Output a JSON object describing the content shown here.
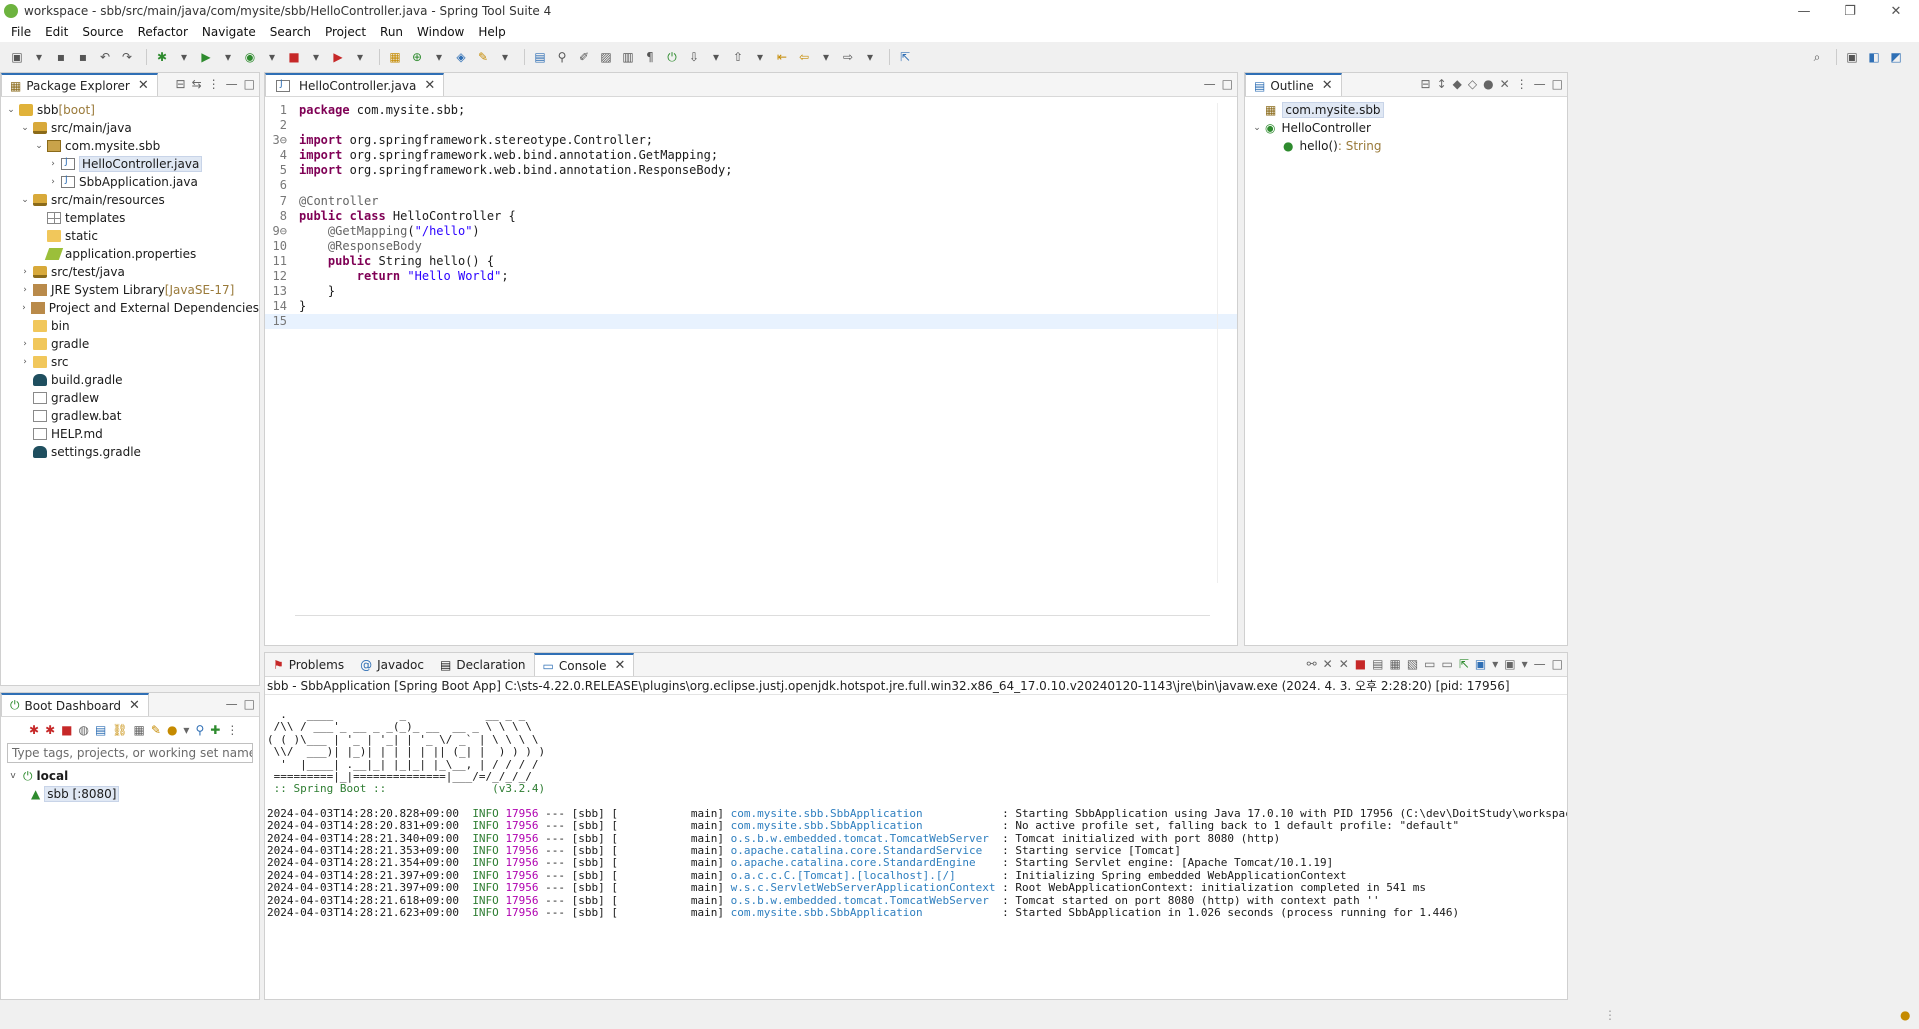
{
  "window": {
    "title": "workspace - sbb/src/main/java/com/mysite/sbb/HelloController.java - Spring Tool Suite 4",
    "controls": [
      "—",
      "❐",
      "✕"
    ]
  },
  "menu": [
    "File",
    "Edit",
    "Source",
    "Refactor",
    "Navigate",
    "Search",
    "Project",
    "Run",
    "Window",
    "Help"
  ],
  "package_explorer": {
    "title": "Package Explorer",
    "tree": [
      {
        "indent": 0,
        "twisty": "v",
        "icon": "proj",
        "label": "sbb",
        "suffix": " [boot]"
      },
      {
        "indent": 1,
        "twisty": "v",
        "icon": "srcf",
        "label": "src/main/java",
        "suffix": ""
      },
      {
        "indent": 2,
        "twisty": "v",
        "icon": "pkgi",
        "label": "com.mysite.sbb",
        "suffix": ""
      },
      {
        "indent": 3,
        "twisty": ">",
        "icon": "jfile",
        "label": "HelloController.java",
        "suffix": "",
        "selected": true
      },
      {
        "indent": 3,
        "twisty": ">",
        "icon": "jfile",
        "label": "SbbApplication.java",
        "suffix": ""
      },
      {
        "indent": 1,
        "twisty": "v",
        "icon": "srcf",
        "label": "src/main/resources",
        "suffix": ""
      },
      {
        "indent": 2,
        "twisty": "",
        "icon": "tmpl",
        "label": "templates",
        "suffix": ""
      },
      {
        "indent": 2,
        "twisty": "",
        "icon": "folder",
        "label": "static",
        "suffix": ""
      },
      {
        "indent": 2,
        "twisty": "",
        "icon": "prop",
        "label": "application.properties",
        "suffix": ""
      },
      {
        "indent": 1,
        "twisty": ">",
        "icon": "srcf",
        "label": "src/test/java",
        "suffix": ""
      },
      {
        "indent": 1,
        "twisty": ">",
        "icon": "lib",
        "label": "JRE System Library",
        "suffix": " [JavaSE-17]"
      },
      {
        "indent": 1,
        "twisty": ">",
        "icon": "lib",
        "label": "Project and External Dependencies",
        "suffix": ""
      },
      {
        "indent": 1,
        "twisty": "",
        "icon": "folder",
        "label": "bin",
        "suffix": ""
      },
      {
        "indent": 1,
        "twisty": ">",
        "icon": "folder",
        "label": "gradle",
        "suffix": ""
      },
      {
        "indent": 1,
        "twisty": ">",
        "icon": "folder",
        "label": "src",
        "suffix": ""
      },
      {
        "indent": 1,
        "twisty": "",
        "icon": "grd",
        "label": "build.gradle",
        "suffix": ""
      },
      {
        "indent": 1,
        "twisty": "",
        "icon": "file",
        "label": "gradlew",
        "suffix": ""
      },
      {
        "indent": 1,
        "twisty": "",
        "icon": "file",
        "label": "gradlew.bat",
        "suffix": ""
      },
      {
        "indent": 1,
        "twisty": "",
        "icon": "file",
        "label": "HELP.md",
        "suffix": ""
      },
      {
        "indent": 1,
        "twisty": "",
        "icon": "grd",
        "label": "settings.gradle",
        "suffix": ""
      }
    ]
  },
  "editor": {
    "tab": "HelloController.java",
    "lines": [
      {
        "n": "1",
        "html": "<span class='kw'>package</span> com.mysite.sbb;"
      },
      {
        "n": "2",
        "html": ""
      },
      {
        "n": "3⊖",
        "html": "<span class='kw'>import</span> org.springframework.stereotype.Controller;"
      },
      {
        "n": "4",
        "html": "<span class='kw'>import</span> org.springframework.web.bind.annotation.GetMapping;"
      },
      {
        "n": "5",
        "html": "<span class='kw'>import</span> org.springframework.web.bind.annotation.ResponseBody;"
      },
      {
        "n": "6",
        "html": ""
      },
      {
        "n": "7",
        "html": "<span class='ann'>@Controller</span>"
      },
      {
        "n": "8",
        "html": "<span class='kw'>public class</span> HelloController {"
      },
      {
        "n": "9⊖",
        "html": "    <span class='ann'>@GetMapping</span>(<span class='str'>\"/hello\"</span>)"
      },
      {
        "n": "10",
        "html": "    <span class='ann'>@ResponseBody</span>"
      },
      {
        "n": "11",
        "html": "    <span class='kw'>public</span> String hello() {"
      },
      {
        "n": "12",
        "html": "        <span class='kw'>return</span> <span class='str'>\"Hello World\"</span>;"
      },
      {
        "n": "13",
        "html": "    }"
      },
      {
        "n": "14",
        "html": "}"
      },
      {
        "n": "15",
        "html": "",
        "current": true
      }
    ]
  },
  "outline": {
    "title": "Outline",
    "items": [
      {
        "indent": 0,
        "twisty": "",
        "label": "com.mysite.sbb",
        "type": "",
        "selected": true
      },
      {
        "indent": 0,
        "twisty": "v",
        "label": "HelloController",
        "type": ""
      },
      {
        "indent": 1,
        "twisty": "",
        "label": "hello()",
        "type": " : String"
      }
    ]
  },
  "boot_dashboard": {
    "title": "Boot Dashboard",
    "search_placeholder": "Type tags, projects, or working set names to match (incl",
    "group": "local",
    "app": "sbb [:8080]"
  },
  "bottom_tabs": {
    "problems": "Problems",
    "javadoc": "Javadoc",
    "declaration": "Declaration",
    "console": "Console"
  },
  "console": {
    "header": "sbb - SbbApplication [Spring Boot App] C:\\sts-4.22.0.RELEASE\\plugins\\org.eclipse.justj.openjdk.hotspot.jre.full.win32.x86_64_17.0.10.v20240120-1143\\jre\\bin\\javaw.exe  (2024. 4. 3. 오후 2:28:20) [pid: 17956]",
    "banner": [
      "  .   ____          _            __ _ _",
      " /\\\\ / ___'_ __ _ _(_)_ __  __ _ \\ \\ \\ \\",
      "( ( )\\___ | '_ | '_| | '_ \\/ _` | \\ \\ \\ \\",
      " \\\\/  ___)| |_)| | | | | || (_| |  ) ) ) )",
      "  '  |____| .__|_| |_|_| |_\\__, | / / / /",
      " =========|_|==============|___/=/_/_/_/",
      " :: Spring Boot ::                (v3.2.4)"
    ],
    "logs": [
      {
        "ts": "2024-04-03T14:28:20.828+09:00",
        "lvl": "INFO",
        "pid": "17956",
        "mid": " --- [sbb] [           main] ",
        "logger": "com.mysite.sbb.SbbApplication           ",
        "msg": " : Starting SbbApplication using Java 17.0.10 with PID 17956 (C:\\dev\\DoitStudy\\workspace\\sbb\\bin\\main started by 이금"
      },
      {
        "ts": "2024-04-03T14:28:20.831+09:00",
        "lvl": "INFO",
        "pid": "17956",
        "mid": " --- [sbb] [           main] ",
        "logger": "com.mysite.sbb.SbbApplication           ",
        "msg": " : No active profile set, falling back to 1 default profile: \"default\""
      },
      {
        "ts": "2024-04-03T14:28:21.340+09:00",
        "lvl": "INFO",
        "pid": "17956",
        "mid": " --- [sbb] [           main] ",
        "logger": "o.s.b.w.embedded.tomcat.TomcatWebServer ",
        "msg": " : Tomcat initialized with port 8080 (http)"
      },
      {
        "ts": "2024-04-03T14:28:21.353+09:00",
        "lvl": "INFO",
        "pid": "17956",
        "mid": " --- [sbb] [           main] ",
        "logger": "o.apache.catalina.core.StandardService  ",
        "msg": " : Starting service [Tomcat]"
      },
      {
        "ts": "2024-04-03T14:28:21.354+09:00",
        "lvl": "INFO",
        "pid": "17956",
        "mid": " --- [sbb] [           main] ",
        "logger": "o.apache.catalina.core.StandardEngine   ",
        "msg": " : Starting Servlet engine: [Apache Tomcat/10.1.19]"
      },
      {
        "ts": "2024-04-03T14:28:21.397+09:00",
        "lvl": "INFO",
        "pid": "17956",
        "mid": " --- [sbb] [           main] ",
        "logger": "o.a.c.c.C.[Tomcat].[localhost].[/]      ",
        "msg": " : Initializing Spring embedded WebApplicationContext"
      },
      {
        "ts": "2024-04-03T14:28:21.397+09:00",
        "lvl": "INFO",
        "pid": "17956",
        "mid": " --- [sbb] [           main] ",
        "logger": "w.s.c.ServletWebServerApplicationContext",
        "msg": " : Root WebApplicationContext: initialization completed in 541 ms"
      },
      {
        "ts": "2024-04-03T14:28:21.618+09:00",
        "lvl": "INFO",
        "pid": "17956",
        "mid": " --- [sbb] [           main] ",
        "logger": "o.s.b.w.embedded.tomcat.TomcatWebServer ",
        "msg": " : Tomcat started on port 8080 (http) with context path ''"
      },
      {
        "ts": "2024-04-03T14:28:21.623+09:00",
        "lvl": "INFO",
        "pid": "17956",
        "mid": " --- [sbb] [           main] ",
        "logger": "com.mysite.sbb.SbbApplication           ",
        "msg": " : Started SbbApplication in 1.026 seconds (process running for 1.446)"
      }
    ]
  }
}
